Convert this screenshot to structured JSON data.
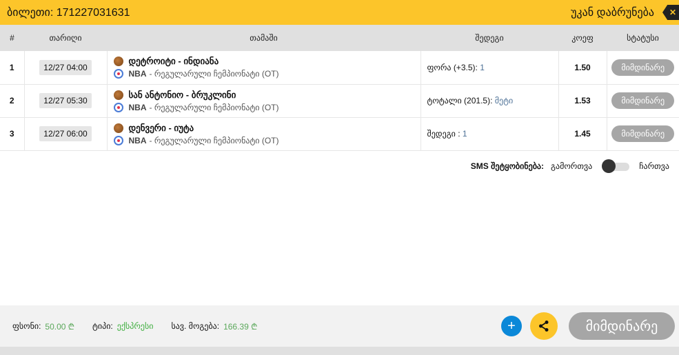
{
  "header": {
    "ticket_label": "ბილეთი:",
    "ticket_id": "171227031631",
    "back_label": "უკან დაბრუნება"
  },
  "columns": [
    "#",
    "თარიღი",
    "თამაში",
    "შედეგი",
    "კოეფ",
    "სტატუსი"
  ],
  "rows": [
    {
      "n": "1",
      "date": "12/27 04:00",
      "game": "დეტროიტი - ინდიანა",
      "league": "NBA",
      "league_detail": "- რეგულარული ჩემპიონატი (OT)",
      "outcome": "ფორა (+3.5):",
      "outcome_value": "1",
      "coef": "1.50",
      "status": "მიმდინარე"
    },
    {
      "n": "2",
      "date": "12/27 05:30",
      "game": "სან ანტონიო - ბრუკლინი",
      "league": "NBA",
      "league_detail": "- რეგულარული ჩემპიონატი (OT)",
      "outcome": "ტოტალი (201.5):",
      "outcome_value": "მეტი",
      "coef": "1.53",
      "status": "მიმდინარე"
    },
    {
      "n": "3",
      "date": "12/27 06:00",
      "game": "დენვერი - იუტა",
      "league": "NBA",
      "league_detail": "- რეგულარული ჩემპიონატი (OT)",
      "outcome": "შედეგი :",
      "outcome_value": "1",
      "coef": "1.45",
      "status": "მიმდინარე"
    }
  ],
  "sms": {
    "label": "SMS შეტყობინება:",
    "off": "გამორთვა",
    "on": "ჩართვა",
    "enabled": false
  },
  "footer": {
    "stake_label": "ფსონი:",
    "stake": "50.00 ₾",
    "type_label": "ტიპი:",
    "type": "ექსპრესი",
    "win_label": "სავ. მოგება:",
    "win": "166.39 ₾",
    "plus": "+",
    "status": "მიმდინარე"
  }
}
